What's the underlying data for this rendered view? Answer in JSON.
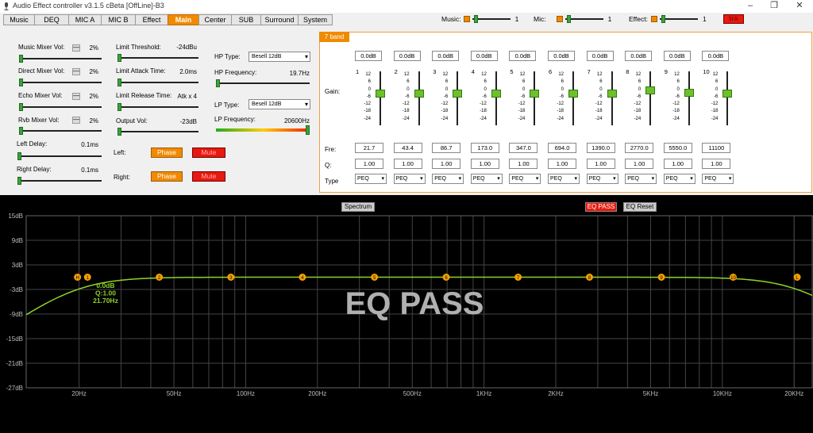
{
  "window": {
    "title": "Audio Effect controller v3.1.5 cBeta [OffLine]-B3"
  },
  "tabs": [
    "Music",
    "DEQ",
    "MIC A",
    "MIC B",
    "Effect",
    "Main",
    "Center",
    "SUB",
    "Surround",
    "System"
  ],
  "active_tab": "Main",
  "top": {
    "music_label": "Music:",
    "music_value": "1",
    "mic_label": "Mic:",
    "mic_value": "1",
    "effect_label": "Effect:",
    "effect_value": "1",
    "link_label": "link"
  },
  "mixer": {
    "music_mixer_label": "Music Mixer Vol:",
    "music_mixer_val": "2%",
    "direct_mixer_label": "Direct Mixer Vol:",
    "direct_mixer_val": "2%",
    "echo_mixer_label": "Echo Mixer Vol:",
    "echo_mixer_val": "2%",
    "rvb_mixer_label": "Rvb Mixer Vol:",
    "rvb_mixer_val": "2%",
    "left_delay_label": "Left Delay:",
    "left_delay_val": "0.1ms",
    "right_delay_label": "Right Delay:",
    "right_delay_val": "0.1ms",
    "minus": "—"
  },
  "limit": {
    "threshold_label": "Limit Threshold:",
    "threshold_val": "-24dBu",
    "attack_label": "Limit Attack Time:",
    "attack_val": "2.0ms",
    "release_label": "Limit Release Time:",
    "release_val": "Atk x 4",
    "output_label": "Output Vol:",
    "output_val": "-23dB"
  },
  "filters": {
    "hp_type_label": "HP Type:",
    "hp_type_val": "Besell 12dB",
    "hp_freq_label": "HP Frequency:",
    "hp_freq_val": "19.7Hz",
    "lp_type_label": "LP Type:",
    "lp_type_val": "Besell 12dB",
    "lp_freq_label": "LP Frequency:",
    "lp_freq_val": "20600Hz"
  },
  "channels": {
    "left_label": "Left:",
    "right_label": "Right:",
    "phase_label": "Phase",
    "mute_label": "Mute"
  },
  "eq": {
    "band_tag": "7 band",
    "gain_label": "Gain:",
    "fre_label": "Fre:",
    "q_label": "Q:",
    "type_label": "Type",
    "ticks": [
      "12",
      "6",
      "0",
      "-6",
      "-12",
      "-18",
      "-24"
    ],
    "bands": [
      {
        "num": "1",
        "gain": "0.0dB",
        "fre": "21.7",
        "q": "1.00",
        "type": "PEQ"
      },
      {
        "num": "2",
        "gain": "0.0dB",
        "fre": "43.4",
        "q": "1.00",
        "type": "PEQ"
      },
      {
        "num": "3",
        "gain": "0.0dB",
        "fre": "86.7",
        "q": "1.00",
        "type": "PEQ"
      },
      {
        "num": "4",
        "gain": "0.0dB",
        "fre": "173.0",
        "q": "1.00",
        "type": "PEQ"
      },
      {
        "num": "5",
        "gain": "0.0dB",
        "fre": "347.0",
        "q": "1.00",
        "type": "PEQ"
      },
      {
        "num": "6",
        "gain": "0.0dB",
        "fre": "694.0",
        "q": "1.00",
        "type": "PEQ"
      },
      {
        "num": "7",
        "gain": "0.0dB",
        "fre": "1390.0",
        "q": "1.00",
        "type": "PEQ"
      },
      {
        "num": "8",
        "gain": "0.0dB",
        "fre": "2770.0",
        "q": "1.00",
        "type": "PEQ"
      },
      {
        "num": "9",
        "gain": "0.0dB",
        "fre": "5550.0",
        "q": "1.00",
        "type": "PEQ"
      },
      {
        "num": "10",
        "gain": "0.0dB",
        "fre": "11100",
        "q": "1.00",
        "type": "PEQ"
      }
    ]
  },
  "graph": {
    "spectrum_label": "Spectrum",
    "eq_pass_button": "EQ PASS",
    "eq_reset_button": "EQ Reset",
    "overlay": "EQ PASS",
    "y_labels": [
      "15dB",
      "9dB",
      "3dB",
      "-3dB",
      "-9dB",
      "-15dB",
      "-21dB",
      "-27dB"
    ],
    "x_labels": [
      "20Hz",
      "50Hz",
      "100Hz",
      "200Hz",
      "500Hz",
      "1KHz",
      "2KHz",
      "5KHz",
      "10KHz",
      "20KHz"
    ],
    "info": [
      "0.0dB",
      "Q:1.00",
      "21.70Hz"
    ],
    "marker_labels": [
      "H",
      "1",
      "2",
      "3",
      "4",
      "5",
      "6",
      "7",
      "8",
      "9",
      "10",
      "L"
    ],
    "colors": {
      "curve": "#8fd32a",
      "marker": "#f5a000",
      "grid": "#444444"
    }
  }
}
